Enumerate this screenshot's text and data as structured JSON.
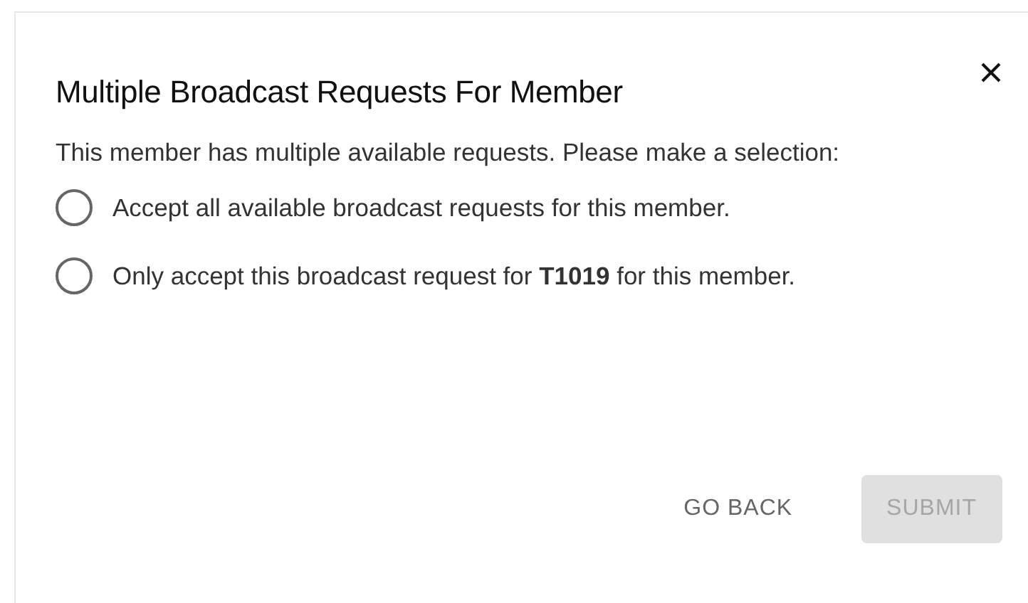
{
  "dialog": {
    "title": "Multiple Broadcast Requests For Member",
    "message": "This member has multiple available requests. Please make a selection:",
    "options": [
      {
        "label": "Accept all available broadcast requests for this member.",
        "selected": false
      },
      {
        "label": "Only accept this broadcast request for **T1019** for this member.",
        "selected": false
      }
    ],
    "buttons": [
      {
        "label": "GO BACK",
        "kind": "text",
        "disabled": false
      },
      {
        "label": "SUBMIT",
        "kind": "contained",
        "disabled": true
      }
    ]
  }
}
